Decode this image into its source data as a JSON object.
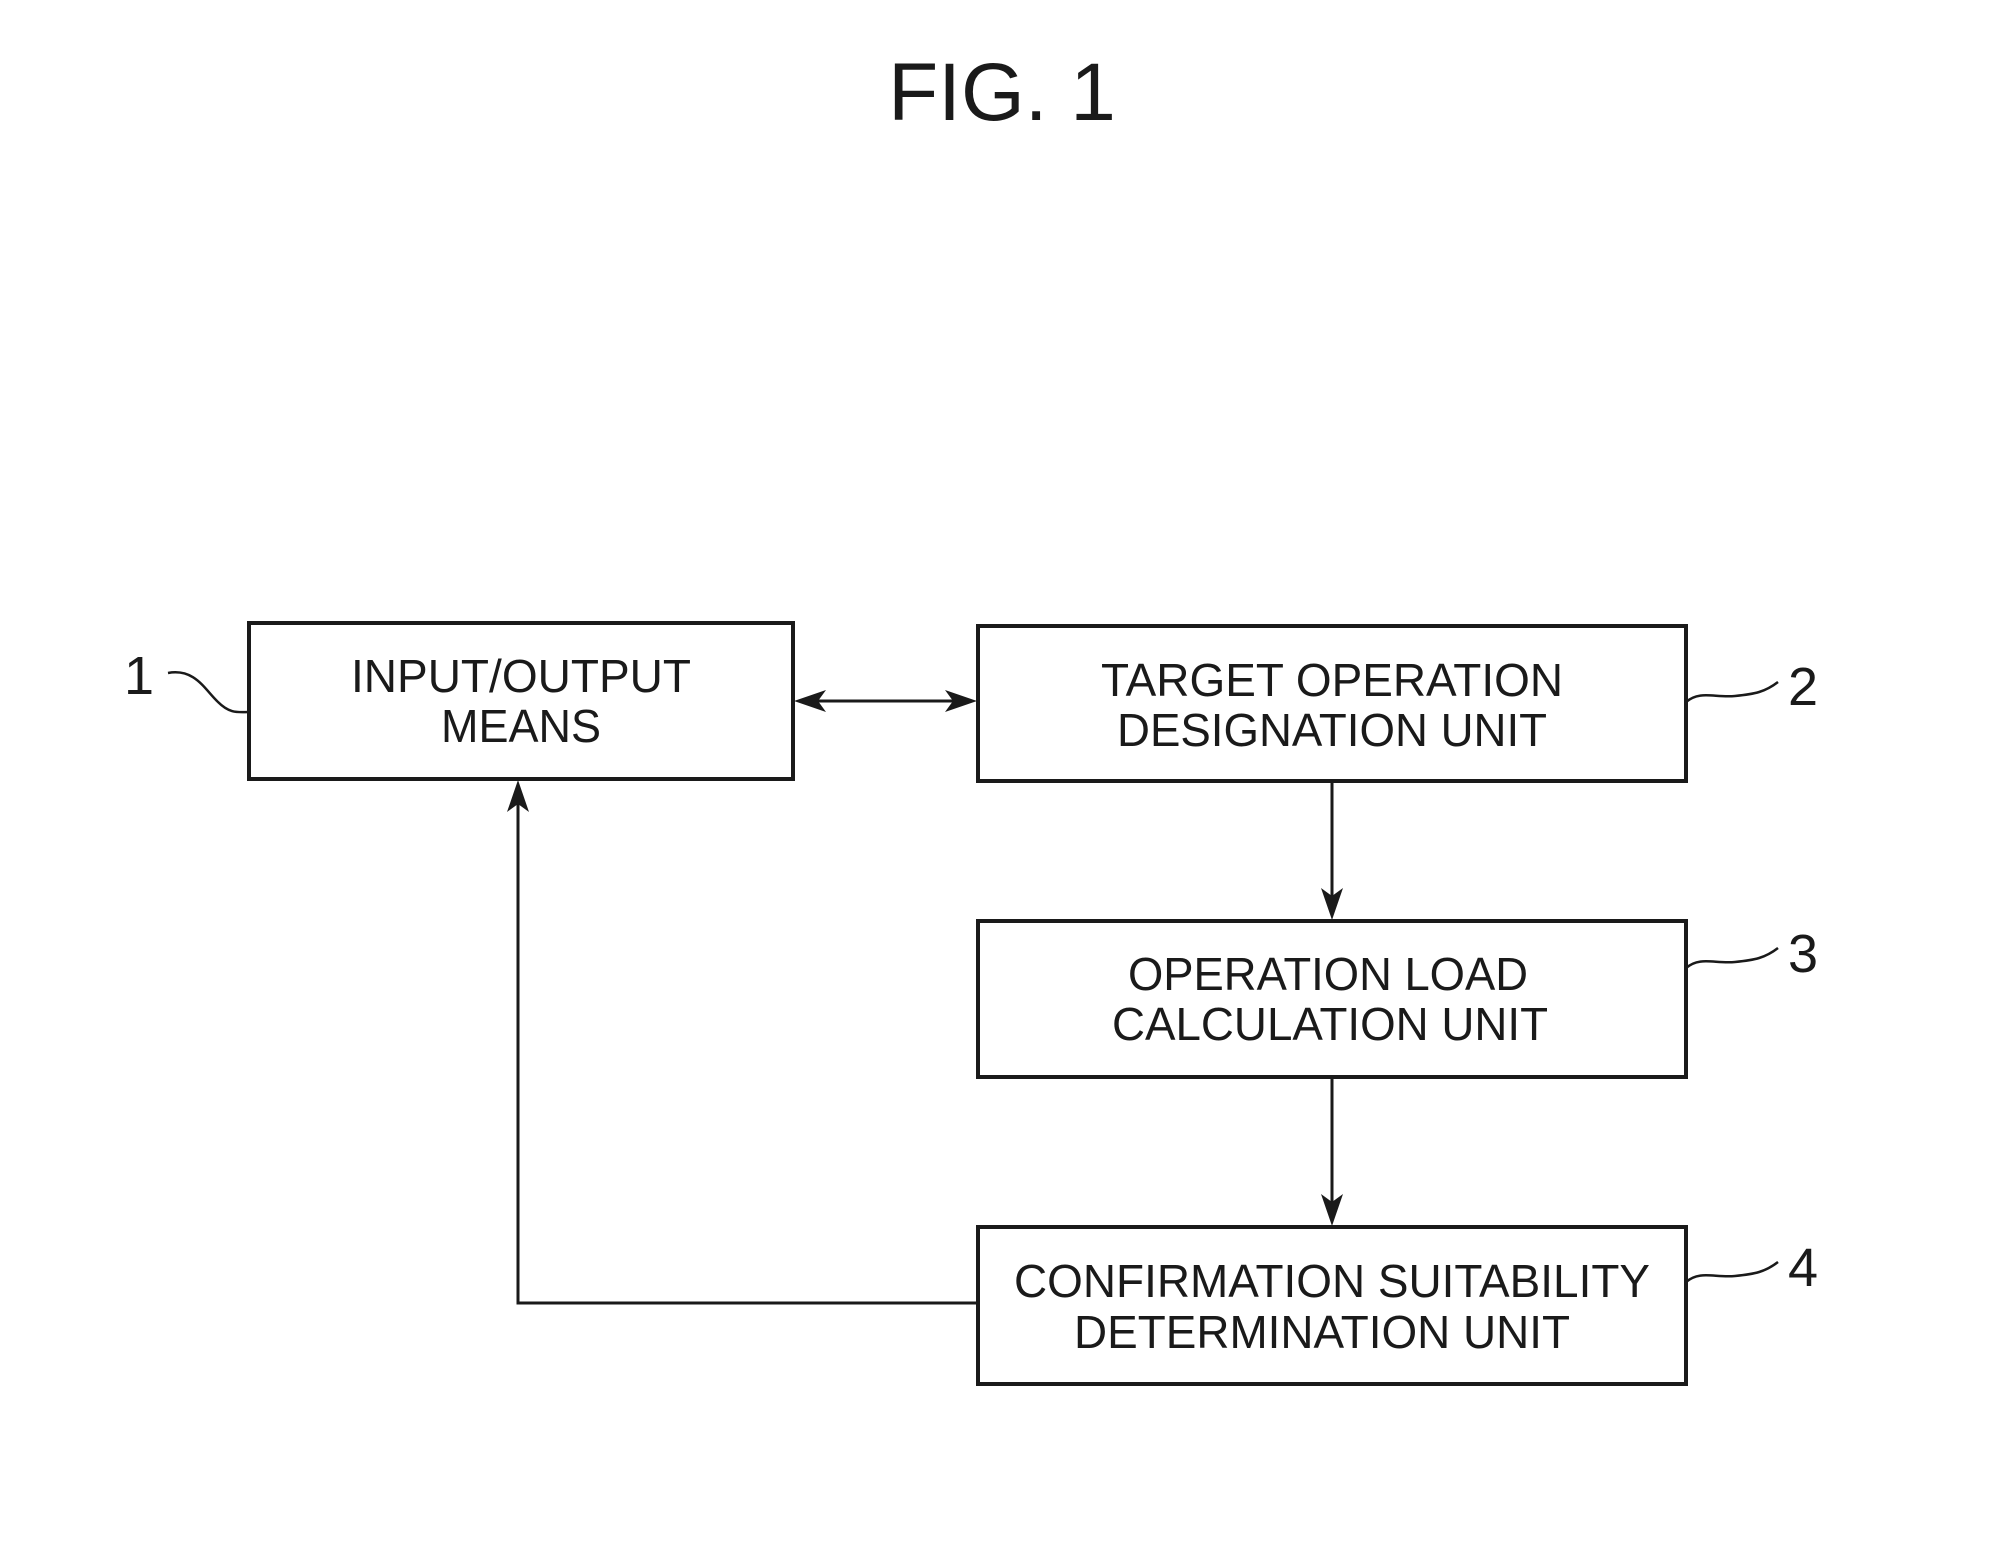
{
  "figure": {
    "title": "FIG. 1"
  },
  "blocks": [
    {
      "ref": "1",
      "line1": "INPUT/OUTPUT",
      "line2": "MEANS"
    },
    {
      "ref": "2",
      "line1": "TARGET OPERATION",
      "line2": "DESIGNATION UNIT"
    },
    {
      "ref": "3",
      "line1": "OPERATION LOAD",
      "line2": "CALCULATION UNIT"
    },
    {
      "ref": "4",
      "line1": "CONFIRMATION SUITABILITY",
      "line2": "DETERMINATION UNIT"
    }
  ],
  "connections": [
    {
      "from": "1",
      "to": "2",
      "type": "bidirectional"
    },
    {
      "from": "2",
      "to": "3",
      "type": "directed"
    },
    {
      "from": "3",
      "to": "4",
      "type": "directed"
    },
    {
      "from": "4",
      "to": "1",
      "type": "directed"
    }
  ]
}
